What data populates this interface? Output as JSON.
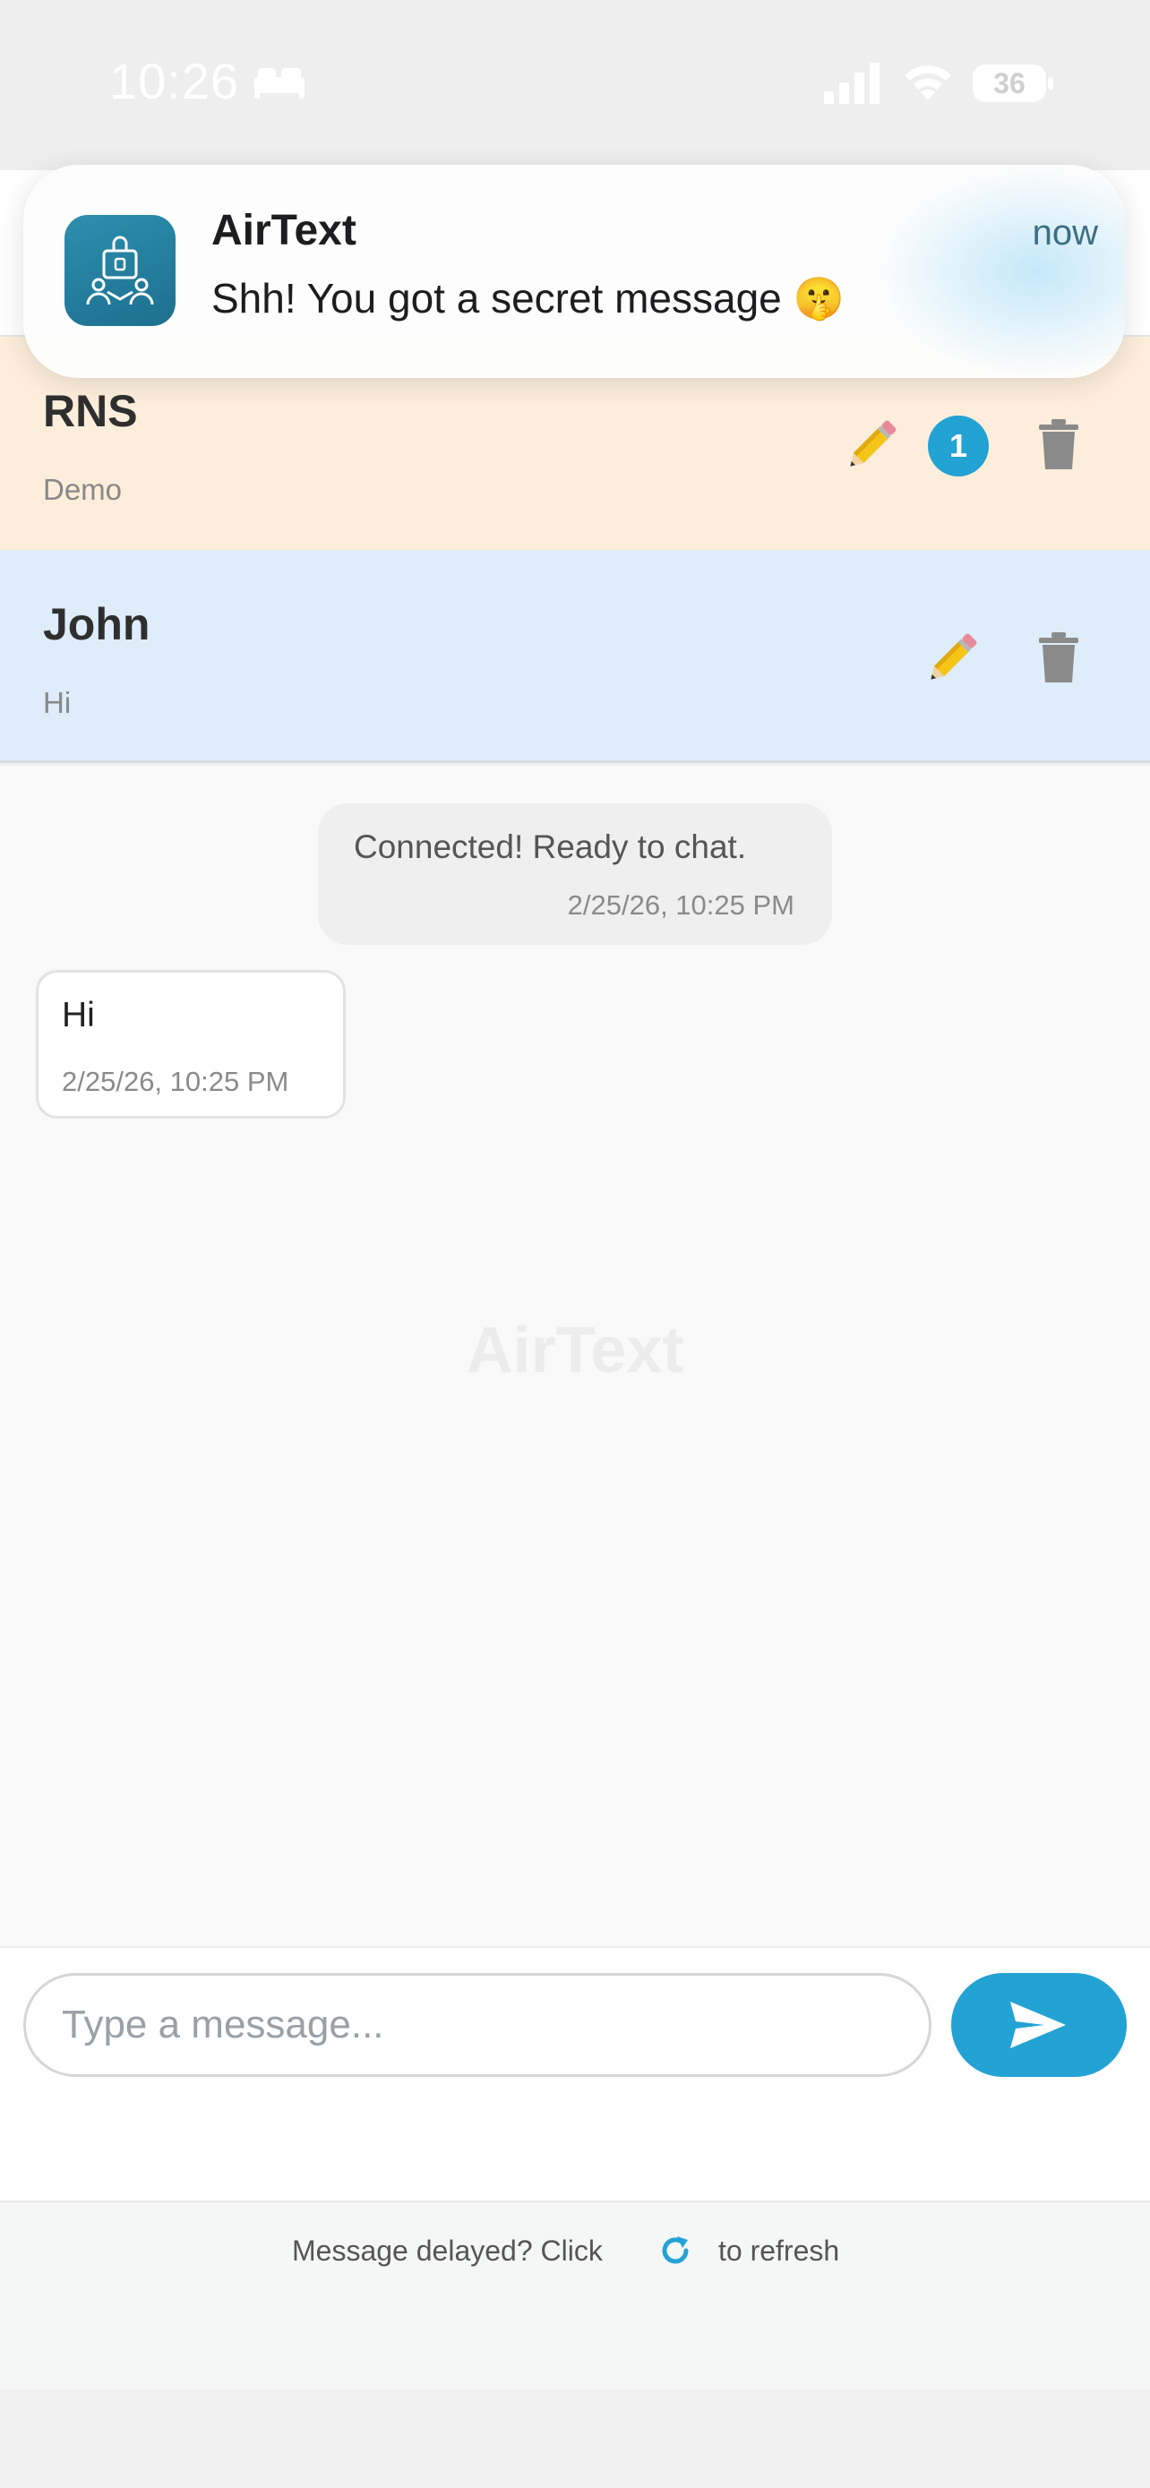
{
  "status_bar": {
    "time": "10:26",
    "battery": "36",
    "icons": [
      "bed-icon",
      "signal-icon",
      "wifi-icon",
      "battery-icon"
    ]
  },
  "notification": {
    "app_name": "AirText",
    "time": "now",
    "body": "Shh! You got a secret message 🤫",
    "icon": "airtext-app-icon"
  },
  "conversations": [
    {
      "name": "RNS",
      "preview": "Demo",
      "unread": "1",
      "background": "#fdeedc",
      "icons": [
        "pencil-icon",
        "trash-icon"
      ]
    },
    {
      "name": "John",
      "preview": "Hi",
      "background": "#deedf9",
      "icons": [
        "pencil-icon",
        "trash-icon"
      ]
    }
  ],
  "chat": {
    "system_message": {
      "text": "Connected! Ready to chat.",
      "time": "2/25/26, 10:25 PM"
    },
    "messages": [
      {
        "text": "Hi",
        "time": "2/25/26, 10:25 PM"
      }
    ],
    "watermark": "AirText"
  },
  "composer": {
    "placeholder": "Type a message...",
    "send_icon": "send-icon"
  },
  "footer": {
    "text_before": "Message delayed? Click",
    "text_after": "to refresh",
    "icon": "refresh-icon"
  },
  "colors": {
    "accent": "#23a2d4",
    "rns_row": "#fdeedc",
    "john_row": "#deedf9",
    "chat_bg": "#f9f9f9"
  }
}
